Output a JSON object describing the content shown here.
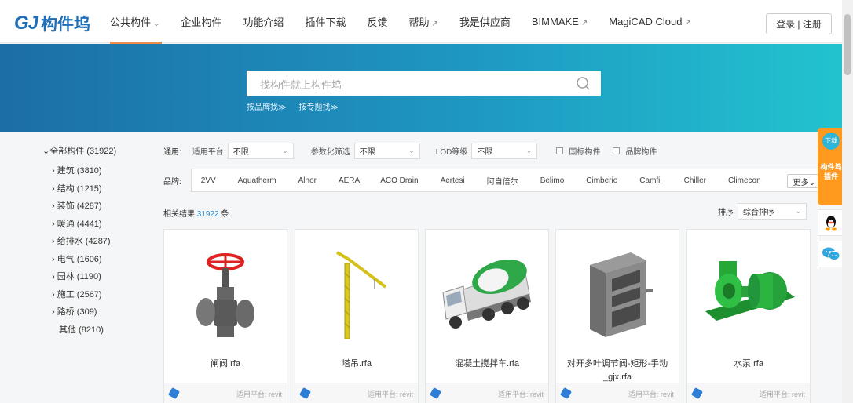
{
  "nav": {
    "logo_mark": "GJ",
    "logo_text": "构件坞",
    "items": [
      {
        "label": "公共构件",
        "arrow": "⌄"
      },
      {
        "label": "企业构件",
        "arrow": ""
      },
      {
        "label": "功能介绍",
        "arrow": ""
      },
      {
        "label": "插件下载",
        "arrow": ""
      },
      {
        "label": "反馈",
        "arrow": ""
      },
      {
        "label": "帮助",
        "arrow": "↗"
      },
      {
        "label": "我是供应商",
        "arrow": ""
      },
      {
        "label": "BIMMAKE",
        "arrow": "↗"
      },
      {
        "label": "MagiCAD Cloud",
        "arrow": "↗"
      }
    ],
    "login": "登录 | 注册"
  },
  "hero": {
    "search_placeholder": "找构件就上构件坞",
    "links": [
      "按品牌找≫",
      "按专题找≫"
    ]
  },
  "sidebar": {
    "root": "全部构件 (31922)",
    "categories": [
      "建筑 (3810)",
      "结构 (1215)",
      "装饰 (4287)",
      "暖通 (4441)",
      "给排水 (4287)",
      "电气 (1606)",
      "园林 (1190)",
      "施工 (2567)",
      "路桥 (309)"
    ],
    "other": "其他 (8210)"
  },
  "filters": {
    "label": "通用:",
    "platform_label": "适用平台",
    "platform_value": "不限",
    "param_label": "参数化筛选",
    "param_value": "不限",
    "lod_label": "LOD等级",
    "lod_value": "不限",
    "national": "国标构件",
    "brand_comp": "品牌构件"
  },
  "brands": {
    "label": "品牌:",
    "items": [
      "2VV",
      "Aquatherm",
      "Alnor",
      "AERA",
      "ACO Drain",
      "Aertesi",
      "阿自倍尔",
      "Belimo",
      "Cimberio",
      "Camfil",
      "Chiller",
      "Climecon"
    ],
    "more": "更多⌄"
  },
  "result": {
    "prefix": "相关结果 ",
    "count": "31922",
    "suffix": " 条"
  },
  "sort": {
    "label": "排序",
    "value": "综合排序"
  },
  "cards": [
    {
      "name": "闸阀.rfa",
      "platform": "适用平台: revit",
      "icon": "gate-valve"
    },
    {
      "name": "塔吊.rfa",
      "platform": "适用平台: revit",
      "icon": "tower-crane"
    },
    {
      "name": "混凝土搅拌车.rfa",
      "platform": "适用平台: revit",
      "icon": "concrete-mixer-truck"
    },
    {
      "name": "对开多叶调节阀-矩形-手动_gjx.rfa",
      "platform": "适用平台: revit",
      "icon": "damper"
    },
    {
      "name": "水泵.rfa",
      "platform": "适用平台: revit",
      "icon": "water-pump"
    }
  ],
  "float_panel": {
    "badge": "下载",
    "label": "构件坞插件"
  },
  "colors": {
    "brand_blue": "#1f6fb8",
    "accent_orange": "#ff9a1f",
    "nav_underline": "#f08b4a",
    "link_blue": "#1f8ad6"
  }
}
